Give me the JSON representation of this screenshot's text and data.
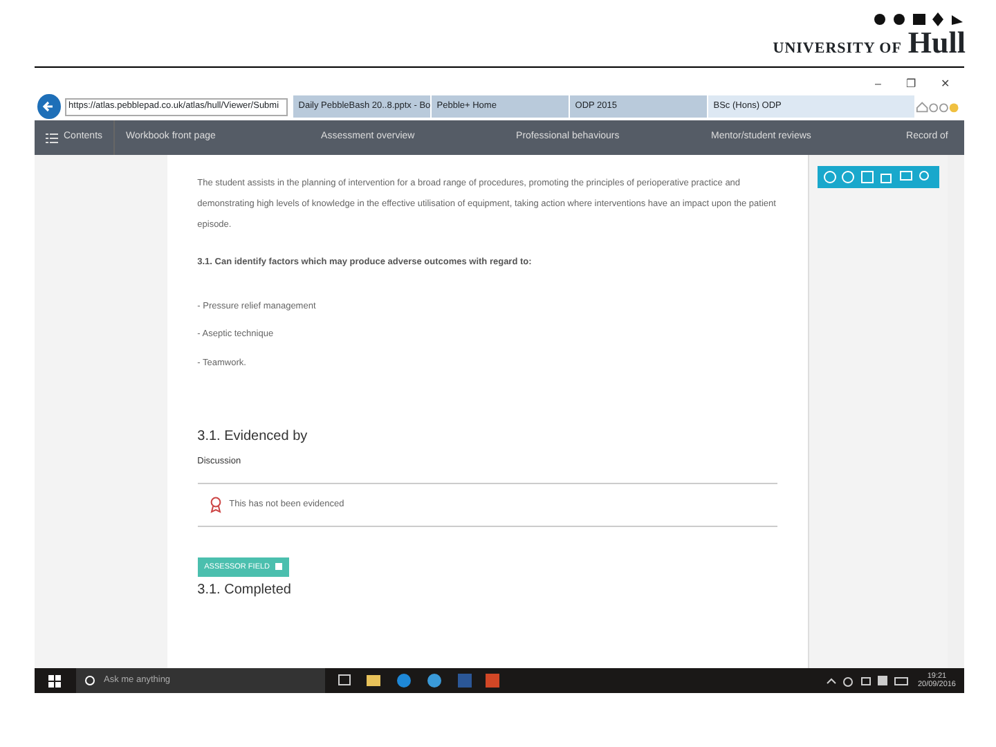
{
  "slide": {
    "logo_small": "UNIVERSITY OF",
    "logo_large": "Hull"
  },
  "window_controls": [
    "–",
    "❐",
    "✕"
  ],
  "address": {
    "url": "https://atlas.pebblepad.co.uk/atlas/hull/Viewer/Submi"
  },
  "tabs": [
    {
      "label": "Daily PebbleBash 20..8.pptx - Bo",
      "selected": false
    },
    {
      "label": "Pebble+ Home",
      "selected": false
    },
    {
      "label": "ODP 2015",
      "selected": false
    },
    {
      "label": "BSc (Hons) ODP",
      "selected": true
    }
  ],
  "nav": {
    "contents": "Contents",
    "items": [
      "Workbook front page",
      "Assessment overview",
      "Professional behaviours",
      "Mentor/student reviews",
      "Record of"
    ]
  },
  "content": {
    "intro": "The student assists in the planning of intervention for a broad range of procedures, promoting the principles of perioperative practice and demonstrating high levels of knowledge in the effective utilisation of equipment, taking action where interventions have an impact upon the patient episode.",
    "criterion": "3.1.  Can identify factors which may produce adverse outcomes with regard to:",
    "factors": [
      "- Pressure relief management",
      "- Aseptic technique",
      "- Teamwork."
    ],
    "evidenced_heading": "3.1. Evidenced by",
    "evidence_type": "Discussion",
    "evidence_status": "This has not been evidenced",
    "badge": "ASSESSOR FIELD",
    "completed_heading": "3.1. Completed"
  },
  "taskbar": {
    "search_placeholder": "Ask me anything",
    "time": "19:21",
    "date": "20/09/2016"
  }
}
